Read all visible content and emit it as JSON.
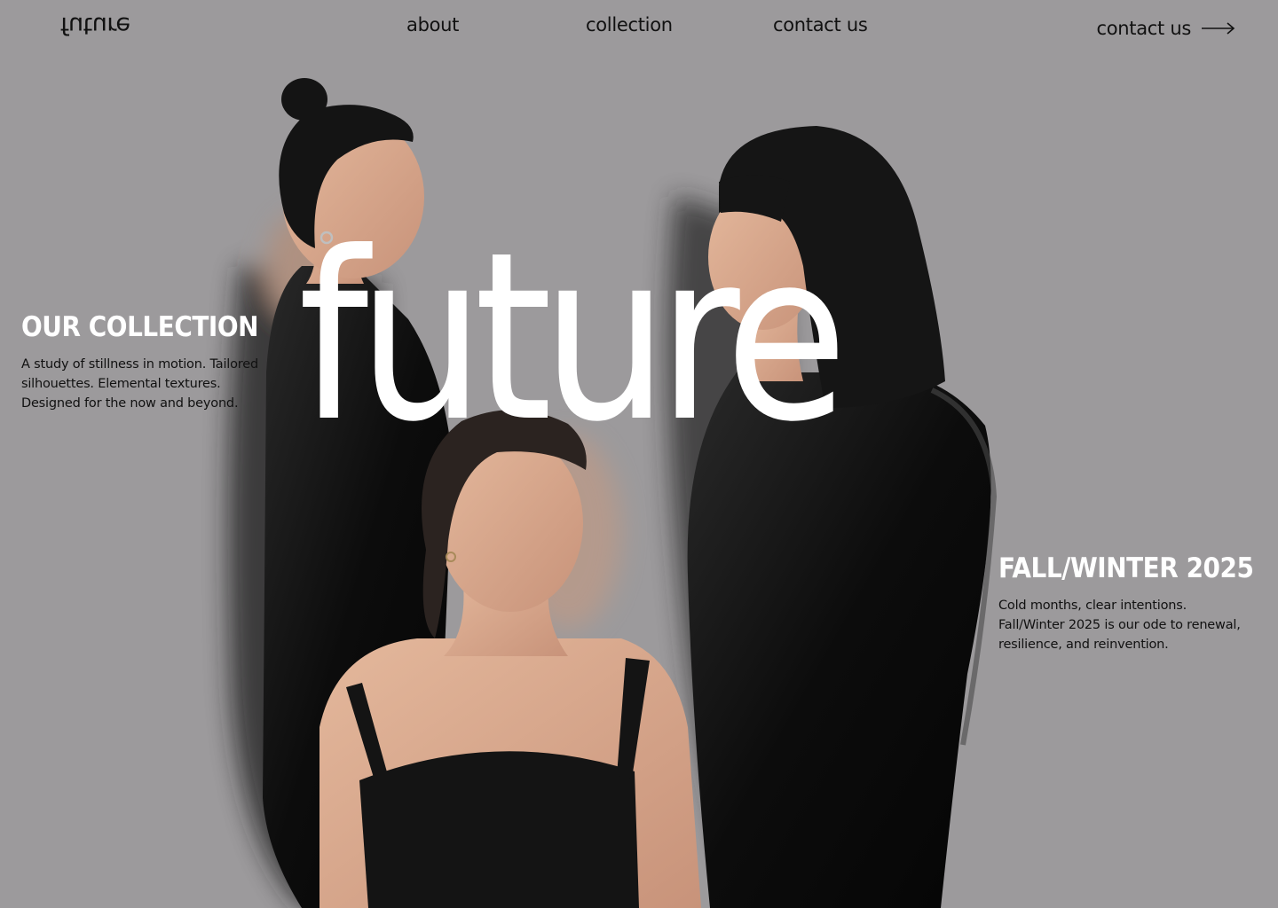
{
  "header": {
    "logo_text": "future",
    "nav": [
      {
        "label": "about"
      },
      {
        "label": "collection"
      },
      {
        "label": "contact us"
      }
    ],
    "cta_label": "contact us",
    "cta_icon": "arrow-right-icon"
  },
  "hero": {
    "headline": "future"
  },
  "left_section": {
    "title": "OUR COLLECTION",
    "body": "A study of stillness in motion. Tailored silhouettes. Elemental textures. Designed for the now and beyond."
  },
  "right_section": {
    "title": "FALL/WINTER 2025",
    "body": "Cold months, clear intentions. Fall/Winter 2025 is our ode to renewal, resilience, and reinvention."
  },
  "colors": {
    "background": "#9c9a9c",
    "headline": "#ffffff",
    "text": "#111111"
  }
}
